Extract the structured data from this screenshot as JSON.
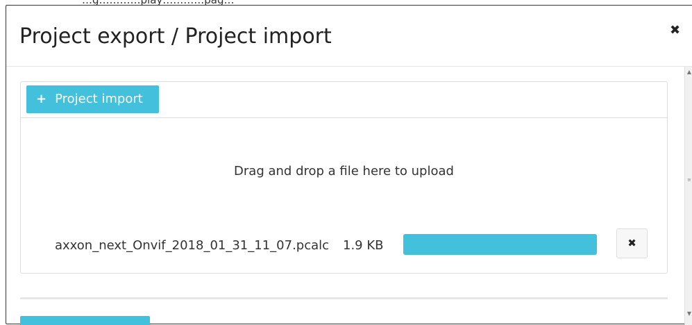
{
  "page_top_text": "…g…………play…………pag…",
  "modal": {
    "title": "Project export / Project import",
    "close_glyph": "✖"
  },
  "panel": {
    "import_button": {
      "icon": "plus-icon",
      "icon_glyph": "+",
      "label": "Project import"
    },
    "drop_zone_text": "Drag and drop a file here to upload",
    "file": {
      "name": "axxon_next_Onvif_2018_01_31_11_07.pcalc",
      "size": "1.9 KB",
      "progress_percent": 100,
      "remove_glyph": "✖"
    }
  },
  "colors": {
    "accent": "#42c0dc",
    "border": "#dddddd"
  }
}
